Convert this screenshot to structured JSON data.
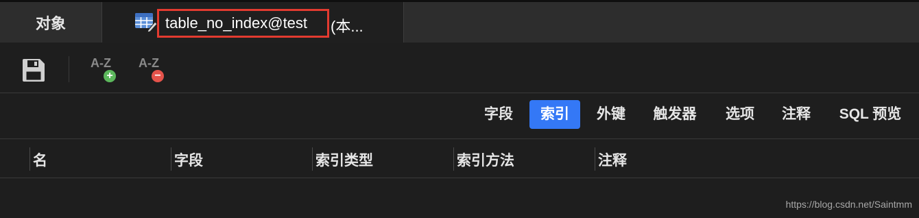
{
  "tabs": {
    "objects_label": "对象",
    "active_title": "table_no_index@test",
    "active_suffix": "(本...",
    "active_icon": "table-edit-icon"
  },
  "toolbar": {
    "save_icon": "save-icon",
    "add_sort_text": "A-Z",
    "add_sort_badge": "+",
    "remove_sort_text": "A-Z",
    "remove_sort_badge": "−",
    "colors": {
      "add": "#5cb85c",
      "remove": "#e5534b"
    }
  },
  "subtabs": [
    {
      "label": "字段",
      "active": false
    },
    {
      "label": "索引",
      "active": true
    },
    {
      "label": "外键",
      "active": false
    },
    {
      "label": "触发器",
      "active": false
    },
    {
      "label": "选项",
      "active": false
    },
    {
      "label": "注释",
      "active": false
    },
    {
      "label": "SQL 预览",
      "active": false
    }
  ],
  "grid": {
    "columns": [
      "名",
      "字段",
      "索引类型",
      "索引方法",
      "注释"
    ]
  },
  "watermark": "https://blog.csdn.net/Saintmm",
  "accent": "#3478f6"
}
